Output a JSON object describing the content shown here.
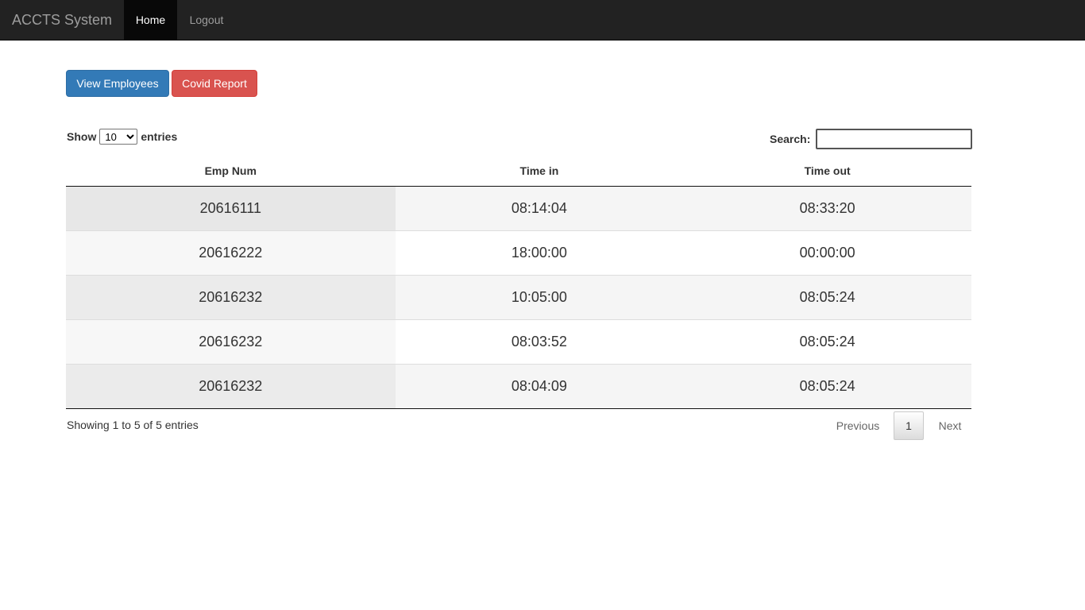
{
  "navbar": {
    "brand": "ACCTS System",
    "home": "Home",
    "logout": "Logout"
  },
  "actions": {
    "view_employees": "View Employees",
    "covid_report": "Covid Report"
  },
  "length": {
    "show_label": "Show",
    "selected": "10",
    "options": [
      "10"
    ],
    "entries_label": "entries"
  },
  "search": {
    "label": "Search:",
    "value": ""
  },
  "table": {
    "columns": [
      "Emp Num",
      "Time in",
      "Time out"
    ],
    "rows": [
      [
        "20616111",
        "08:14:04",
        "08:33:20"
      ],
      [
        "20616222",
        "18:00:00",
        "00:00:00"
      ],
      [
        "20616232",
        "10:05:00",
        "08:05:24"
      ],
      [
        "20616232",
        "08:03:52",
        "08:05:24"
      ],
      [
        "20616232",
        "08:04:09",
        "08:05:24"
      ]
    ]
  },
  "footer": {
    "info": "Showing 1 to 5 of 5 entries",
    "previous": "Previous",
    "current_page": "1",
    "next": "Next"
  },
  "colors": {
    "navbar_bg": "#222222",
    "primary": "#337ab7",
    "danger": "#d9534f"
  }
}
